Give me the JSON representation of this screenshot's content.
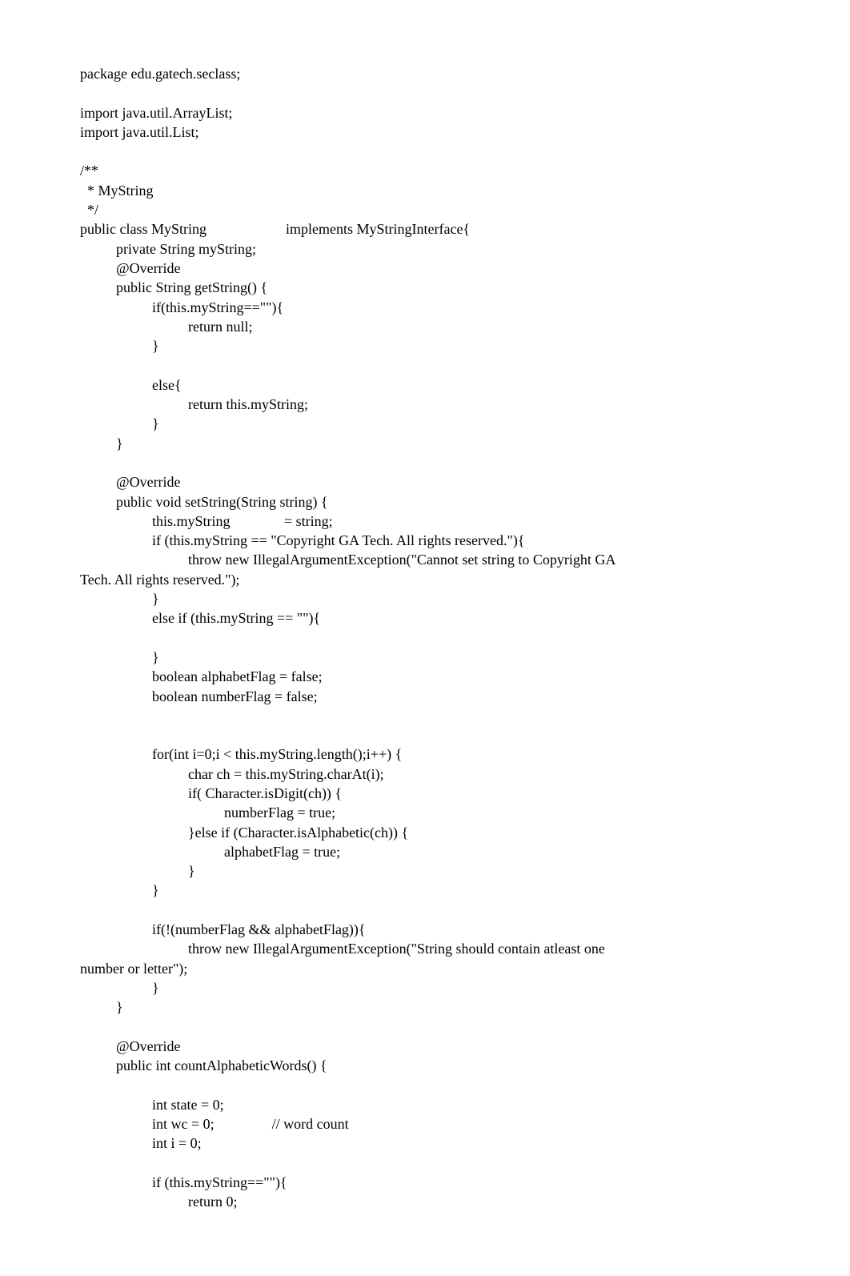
{
  "code": {
    "lines": [
      "package edu.gatech.seclass;",
      "",
      "import java.util.ArrayList;",
      "import java.util.List;",
      "",
      "/**",
      "  * MyString",
      "  */",
      "public class MyString                      implements MyStringInterface{",
      "          private String myString;",
      "          @Override",
      "          public String getString() {",
      "                    if(this.myString==\"\"){",
      "                              return null;",
      "                    }",
      "",
      "                    else{",
      "                              return this.myString;",
      "                    }",
      "          }",
      "",
      "          @Override",
      "          public void setString(String string) {",
      "                    this.myString               = string;",
      "                    if (this.myString == \"Copyright GA Tech. All rights reserved.\"){",
      "                              throw new IllegalArgumentException(\"Cannot set string to Copyright GA",
      "Tech. All rights reserved.\");",
      "                    }",
      "                    else if (this.myString == \"\"){",
      "",
      "                    }",
      "                    boolean alphabetFlag = false;",
      "                    boolean numberFlag = false;",
      "",
      "",
      "                    for(int i=0;i < this.myString.length();i++) {",
      "                              char ch = this.myString.charAt(i);",
      "                              if( Character.isDigit(ch)) {",
      "                                        numberFlag = true;",
      "                              }else if (Character.isAlphabetic(ch)) {",
      "                                        alphabetFlag = true;",
      "                              }",
      "                    }",
      "",
      "                    if(!(numberFlag && alphabetFlag)){",
      "                              throw new IllegalArgumentException(\"String should contain atleast one",
      "number or letter\");",
      "                    }",
      "          }",
      "",
      "          @Override",
      "          public int countAlphabeticWords() {",
      "",
      "                    int state = 0;",
      "                    int wc = 0;                // word count",
      "                    int i = 0;",
      "",
      "                    if (this.myString==\"\"){",
      "                              return 0;"
    ]
  }
}
